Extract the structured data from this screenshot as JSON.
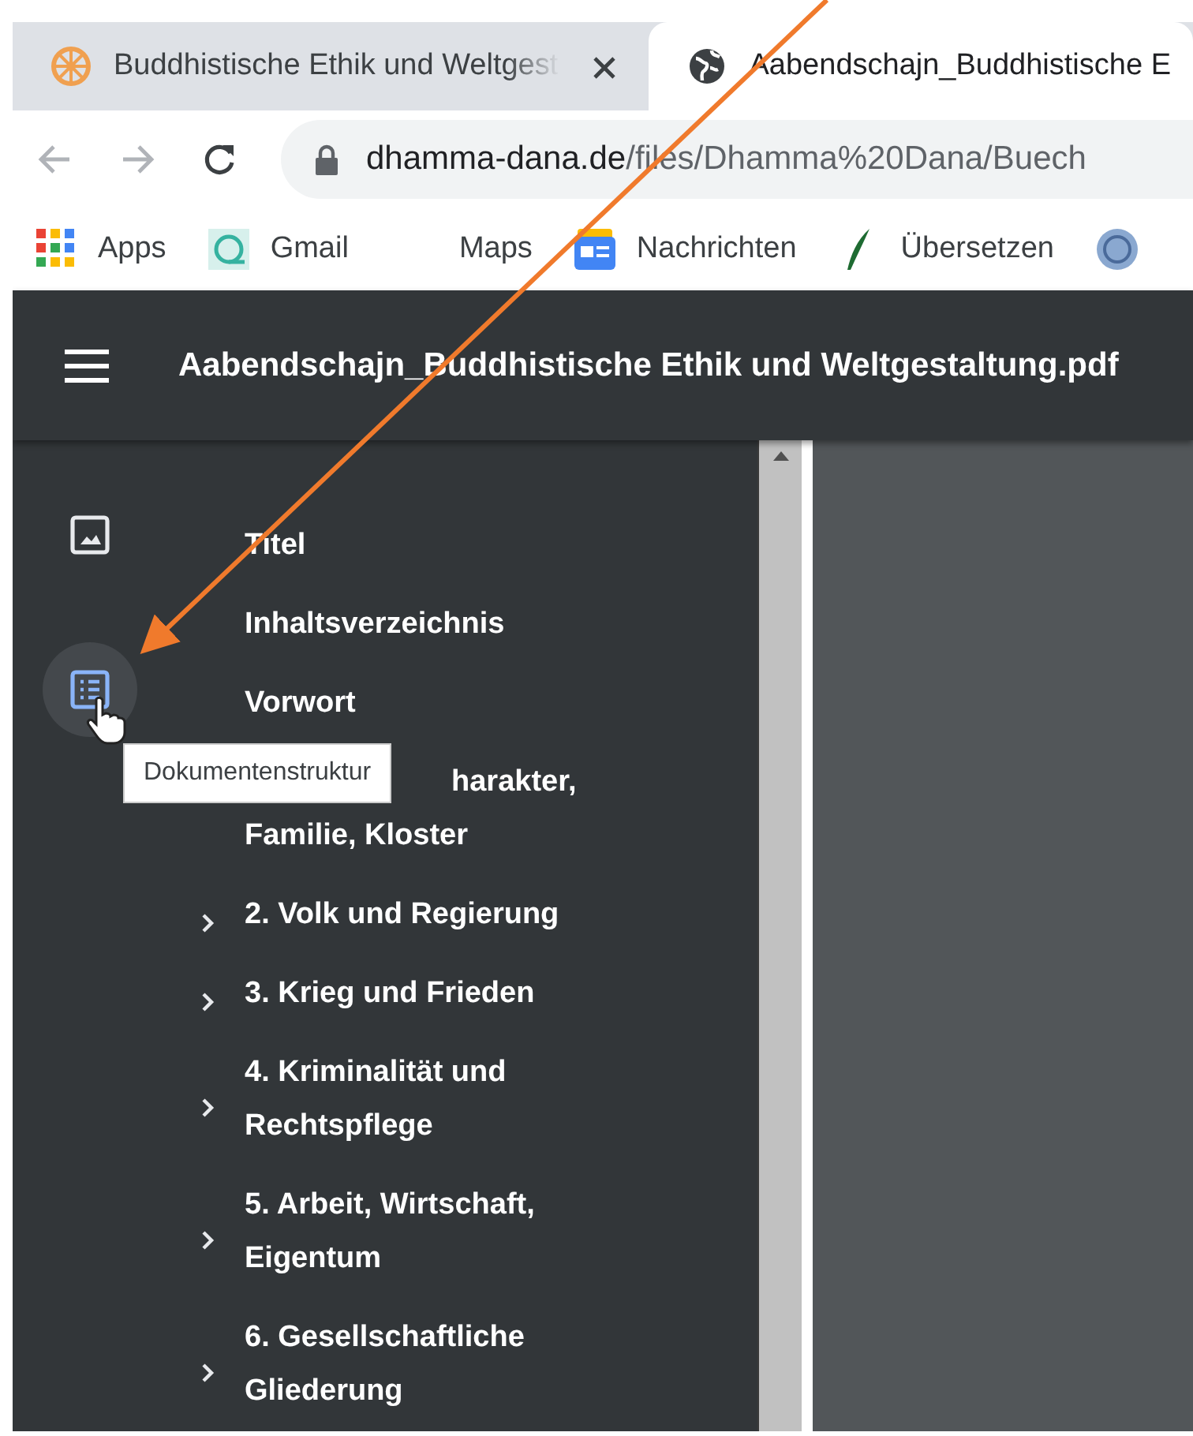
{
  "browser_tabs": [
    {
      "title": "Buddhistische Ethik und Weltgest",
      "selected": false
    },
    {
      "title": "Aabendschajn_Buddhistische E",
      "selected": true
    }
  ],
  "address_bar": {
    "host": "dhamma-dana.de",
    "path": "/files/Dhamma%20Dana/Buech"
  },
  "bookmarks": [
    {
      "label": "Apps"
    },
    {
      "label": "Gmail"
    },
    {
      "label": "Maps"
    },
    {
      "label": "Nachrichten"
    },
    {
      "label": "Übersetzen"
    }
  ],
  "pdf_toolbar": {
    "title": "Aabendschajn_Buddhistische Ethik und Weltgestaltung.pdf"
  },
  "sidebar_buttons": [
    {
      "kind": "thumbnails",
      "selected": false
    },
    {
      "kind": "outline",
      "selected": true
    }
  ],
  "tooltip": "Dokumentenstruktur",
  "outline": [
    {
      "kind": "leaf",
      "lines": [
        "Titel"
      ]
    },
    {
      "kind": "leaf",
      "lines": [
        "Inhaltsverzeichnis"
      ]
    },
    {
      "kind": "leaf",
      "lines": [
        "Vorwort"
      ]
    },
    {
      "kind": "covered",
      "lines": [
        "harakter,",
        "Familie, Kloster"
      ]
    },
    {
      "kind": "branch",
      "lines": [
        "2. Volk und Regierung"
      ]
    },
    {
      "kind": "branch",
      "lines": [
        "3. Krieg und Frieden"
      ]
    },
    {
      "kind": "branch",
      "lines": [
        "4. Kriminalität und",
        "Rechtspflege"
      ]
    },
    {
      "kind": "branch",
      "lines": [
        "5. Arbeit, Wirtschaft,",
        "Eigentum"
      ]
    },
    {
      "kind": "branch",
      "lines": [
        "6. Gesellschaftliche",
        "Gliederung"
      ]
    }
  ]
}
